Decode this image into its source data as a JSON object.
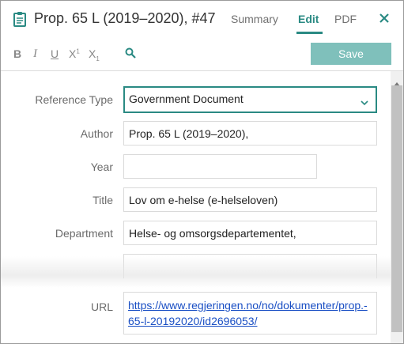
{
  "header": {
    "title": "Prop. 65 L (2019–2020),  #47",
    "tabs": [
      {
        "label": "Summary"
      },
      {
        "label": "Edit"
      },
      {
        "label": "PDF"
      }
    ],
    "active_tab": "Edit"
  },
  "toolbar": {
    "bold_label": "B",
    "italic_label": "I",
    "underline_label": "U",
    "superscript_label": "X",
    "superscript_mark": "1",
    "subscript_label": "X",
    "subscript_mark": "1",
    "save_label": "Save"
  },
  "form": {
    "fields": [
      {
        "label": "Reference Type",
        "value": "Government Document"
      },
      {
        "label": "Author",
        "value": "Prop. 65 L (2019–2020),"
      },
      {
        "label": "Year",
        "value": ""
      },
      {
        "label": "Title",
        "value": "Lov om e-helse (e-helseloven)"
      },
      {
        "label": "Department",
        "value": "Helse- og omsorgsdepartementet,"
      },
      {
        "label": "URL",
        "value": "https://www.regjeringen.no/no/dokumenter/prop.-65-l-20192020/id2696053/"
      }
    ]
  },
  "colors": {
    "accent": "#2a8a83",
    "save_button": "#7fc0bb",
    "link": "#1a4fc4"
  },
  "icons": [
    "document-icon",
    "close-icon",
    "search-icon",
    "chevron-down-icon",
    "scroll-up-arrow-icon"
  ]
}
